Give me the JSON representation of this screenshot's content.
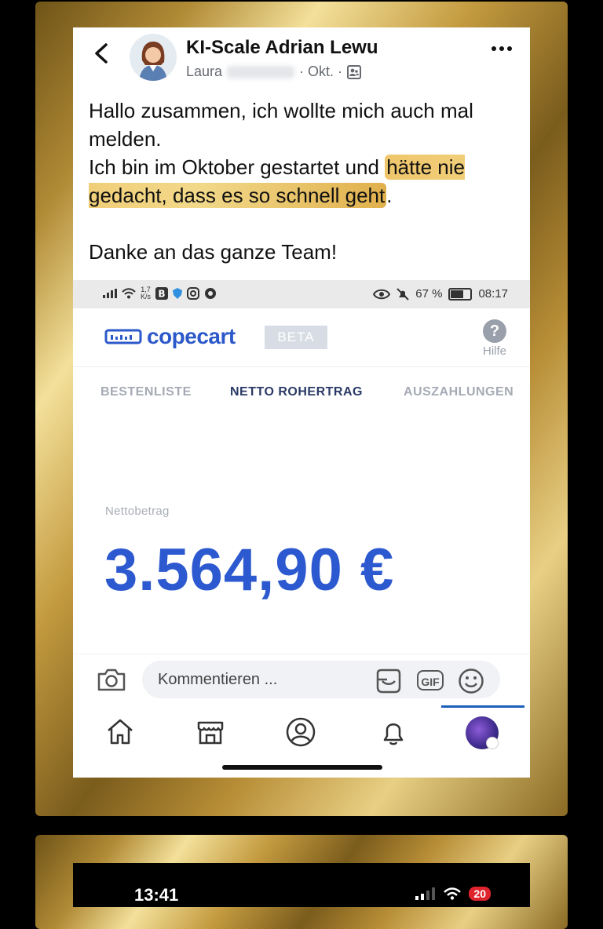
{
  "post": {
    "title": "KI-Scale Adrian Lewu",
    "author_first_name": "Laura",
    "date": "· Okt. ·",
    "body_line1": "Hallo zusammen, ich wollte mich auch mal melden.",
    "body_line2_prefix": "Ich bin im Oktober gestartet und ",
    "body_line2_highlight": "hätte nie gedacht, dass es so schnell geht",
    "body_line2_suffix": ".",
    "body_line3": "Danke an das ganze Team!"
  },
  "phone_status": {
    "speed_value": "1,7",
    "speed_unit": "K/s",
    "battery": "67 %",
    "time": "08:17"
  },
  "copecart": {
    "logo": "copecart",
    "beta": "BETA",
    "help": "Hilfe",
    "tabs": [
      "BESTENLISTE",
      "NETTO ROHERTRAG",
      "AUSZAHLUNGEN"
    ],
    "active_tab": "NETTO ROHERTRAG",
    "net_label": "Nettobetrag",
    "net_amount": "3.564,90 €"
  },
  "comment": {
    "placeholder": "Kommentieren ...",
    "gif": "GIF"
  },
  "second_screen": {
    "time": "13:41",
    "battery": "20"
  },
  "colors": {
    "brand_blue": "#2d59d0",
    "highlight_gold": "#efc66b"
  }
}
